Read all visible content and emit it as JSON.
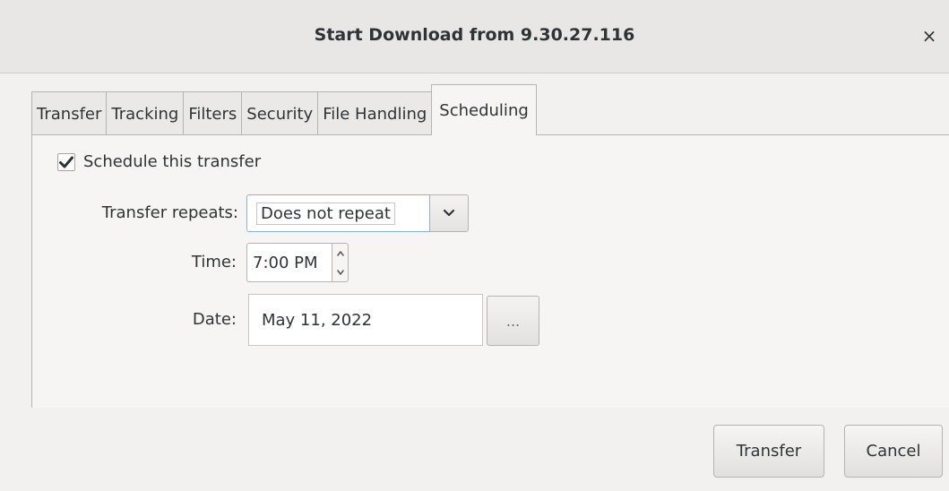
{
  "window": {
    "title": "Start Download from 9.30.27.116",
    "close_glyph": "×"
  },
  "tabs": [
    {
      "label": "Transfer",
      "active": false
    },
    {
      "label": "Tracking",
      "active": false
    },
    {
      "label": "Filters",
      "active": false
    },
    {
      "label": "Security",
      "active": false
    },
    {
      "label": "File Handling",
      "active": false
    },
    {
      "label": "Scheduling",
      "active": true
    }
  ],
  "scheduling": {
    "schedule_checkbox": {
      "label": "Schedule this transfer",
      "checked": true
    },
    "repeats": {
      "label": "Transfer repeats:",
      "value": "Does not repeat"
    },
    "time": {
      "label": "Time:",
      "value": "7:00 PM"
    },
    "date": {
      "label": "Date:",
      "value": "May 11, 2022",
      "picker_label": "..."
    }
  },
  "buttons": {
    "transfer": "Transfer",
    "cancel": "Cancel"
  },
  "icons": {
    "close": "close-icon",
    "check": "checkmark-icon",
    "dropdown": "chevron-down-icon",
    "spin_up": "chevron-up-icon",
    "spin_down": "chevron-down-icon"
  }
}
